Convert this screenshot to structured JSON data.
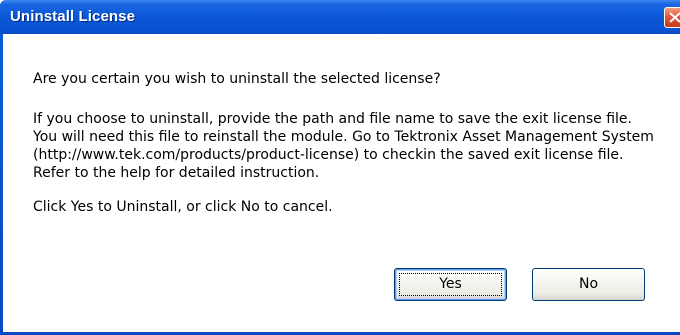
{
  "window": {
    "title": "Uninstall License",
    "close_icon": "close-icon"
  },
  "message": {
    "question": "Are you certain you wish to uninstall the selected license?",
    "paragraph_lines": [
      "If you choose to uninstall, provide the path and file name to save the exit license file.",
      "You will need this file to reinstall the module. Go to Tektronix Asset Management System",
      "(http://www.tek.com/products/product-license) to checkin the saved exit license file.",
      "Refer to the help for detailed instruction."
    ],
    "instruction": "Click Yes to Uninstall, or click No to cancel."
  },
  "buttons": {
    "yes_label": "Yes",
    "no_label": "No"
  },
  "colors": {
    "titlebar": "#0a53d2",
    "close_button": "#e0583a",
    "button_border": "#003c74"
  }
}
